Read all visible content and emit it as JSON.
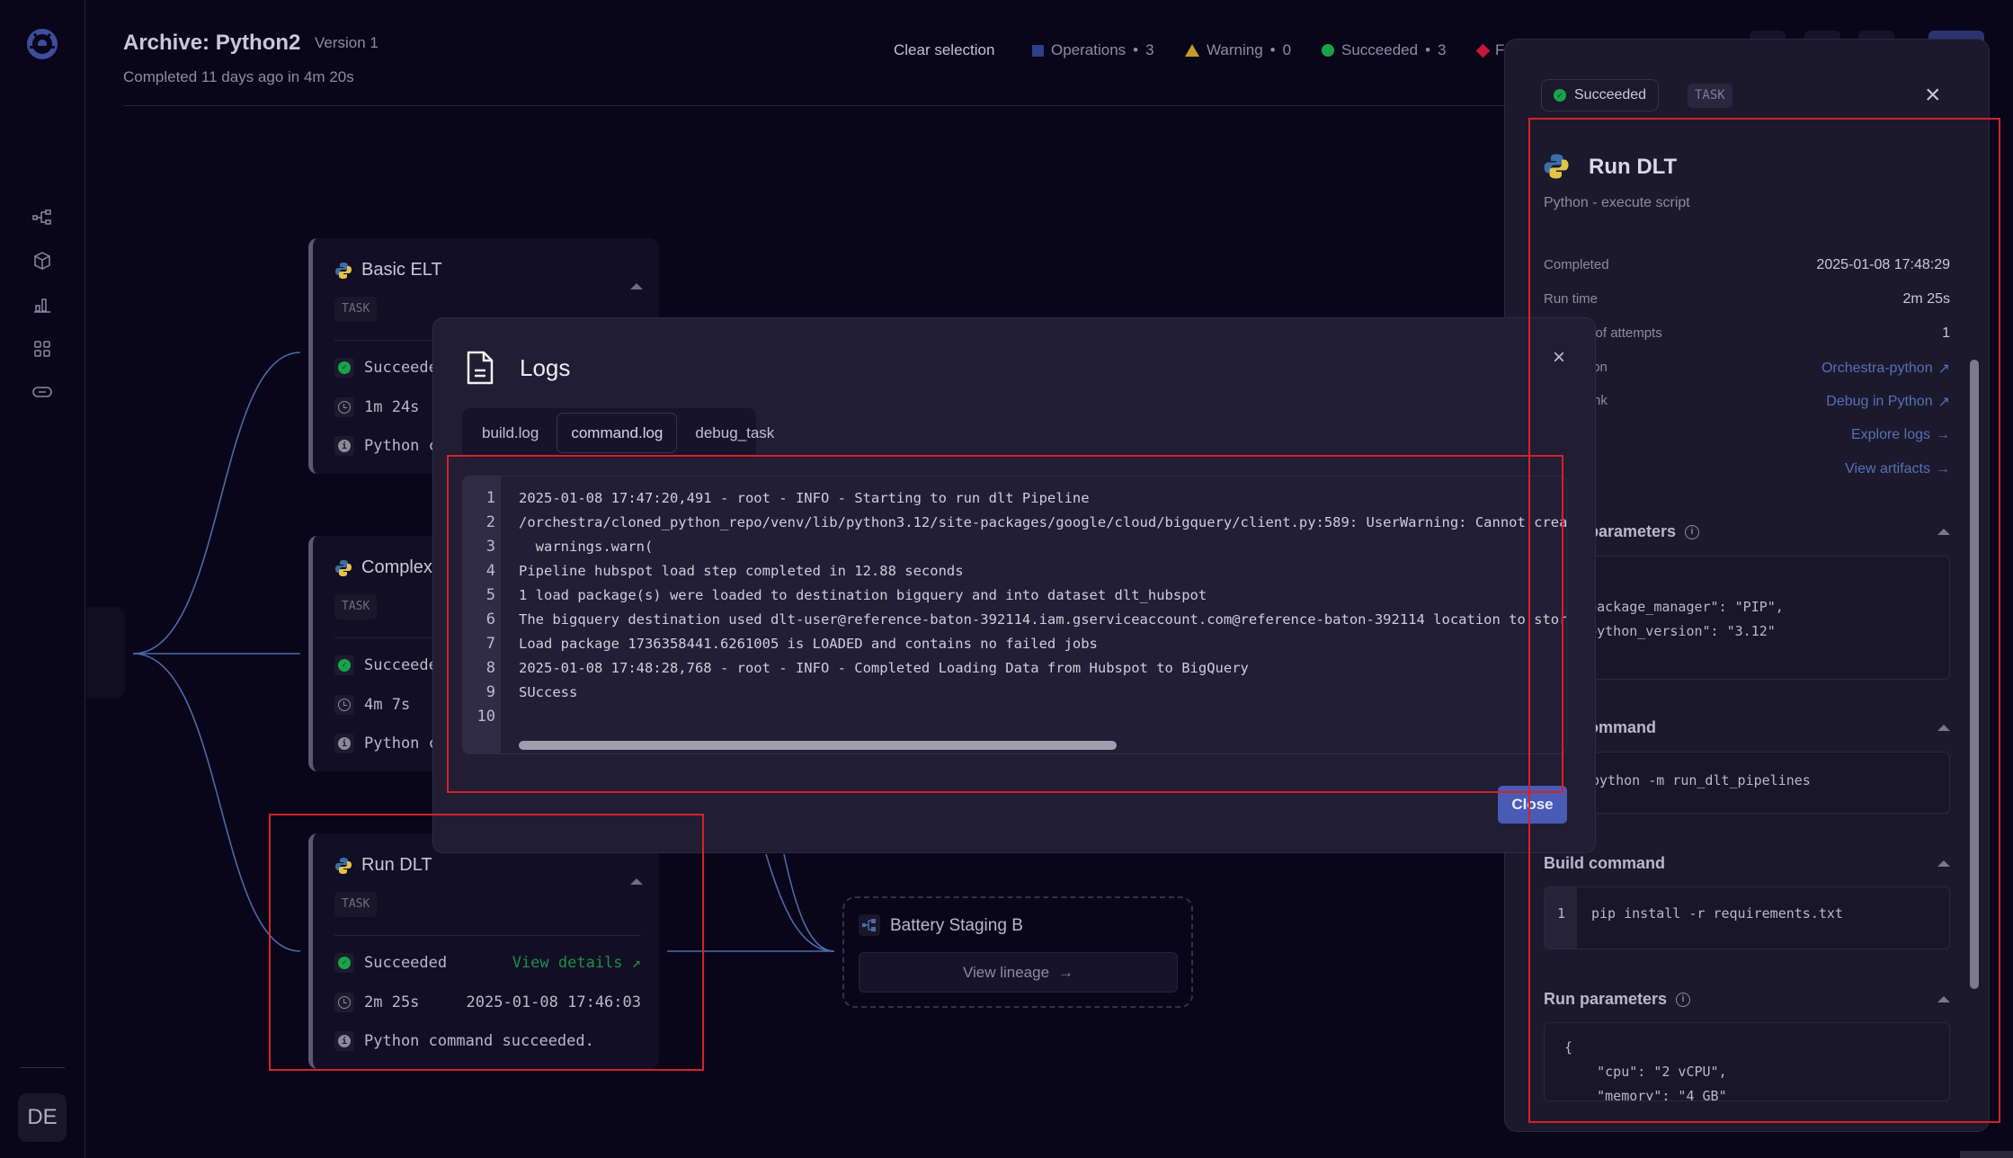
{
  "sidebar": {
    "nav_icons": [
      "pipelines-icon",
      "packages-icon",
      "analytics-icon",
      "integrations-icon",
      "links-icon"
    ],
    "avatar_initials": "DE"
  },
  "header": {
    "title": "Archive: Python2",
    "version": "Version 1",
    "subtitle": "Completed 11 days ago in 4m 20s",
    "clear_selection": "Clear selection",
    "stats": [
      {
        "label": "Operations",
        "count": "3",
        "icon": "operations-icon",
        "color": "#3b4fa0"
      },
      {
        "label": "Warning",
        "count": "0",
        "icon": "warning-icon",
        "color": "#c89a2a"
      },
      {
        "label": "Succeeded",
        "count": "3",
        "icon": "success-icon",
        "color": "#17a34a"
      },
      {
        "label": "F",
        "count": "",
        "icon": "failed-icon",
        "color": "#c8173a"
      }
    ],
    "separator": "•"
  },
  "dag": {
    "tasks": [
      {
        "name": "Basic ELT",
        "tag": "TASK",
        "status": "Succeede",
        "duration": "1m 24s",
        "message": "Python c",
        "timestamp": "",
        "link": ""
      },
      {
        "name": "Complex",
        "tag": "TASK",
        "status": "Succeede",
        "duration": "4m 7s",
        "message": "Python c",
        "timestamp": "",
        "link": ""
      },
      {
        "name": "Run DLT",
        "tag": "TASK",
        "status": "Succeeded",
        "duration": "2m 25s",
        "message": "Python command succeeded.",
        "timestamp": "2025-01-08 17:46:03",
        "link": "View details ↗"
      }
    ],
    "lineage": {
      "name": "Battery Staging B",
      "button": "View lineage",
      "arrow": "→"
    }
  },
  "logs_modal": {
    "title": "Logs",
    "close_x": "×",
    "tabs": [
      "build.log",
      "command.log",
      "debug_task"
    ],
    "active_tab": "command.log",
    "lines": [
      "2025-01-08 17:47:20,491 - root - INFO - Starting to run dlt Pipeline",
      "/orchestra/cloned_python_repo/venv/lib/python3.12/site-packages/google/cloud/bigquery/client.py:589: UserWarning: Cannot creat",
      "  warnings.warn(",
      "Pipeline hubspot load step completed in 12.88 seconds",
      "1 load package(s) were loaded to destination bigquery and into dataset dlt_hubspot",
      "The bigquery destination used dlt-user@reference-baton-392114.iam.gserviceaccount.com@reference-baton-392114 location to store",
      "Load package 1736358441.6261005 is LOADED and contains no failed jobs",
      "2025-01-08 17:48:28,768 - root - INFO - Completed Loading Data from Hubspot to BigQuery",
      "SUccess",
      ""
    ],
    "line_numbers": [
      "1",
      "2",
      "3",
      "4",
      "5",
      "6",
      "7",
      "8",
      "9",
      "10"
    ],
    "close_button": "Close"
  },
  "detail_panel": {
    "status": "Succeeded",
    "tag": "TASK",
    "close_x": "×",
    "title": "Run DLT",
    "subtitle": "Python - execute script",
    "fields": [
      {
        "label": "Completed",
        "value": "2025-01-08 17:48:29"
      },
      {
        "label": "Run time",
        "value": "2m 25s"
      },
      {
        "label": "Number of attempts",
        "value": "1"
      }
    ],
    "links": [
      {
        "label": "Integration",
        "value": "Orchestra-python",
        "icon": "external-link-icon"
      },
      {
        "label": "Debug link",
        "value": "Debug in Python",
        "icon": "external-link-icon"
      },
      {
        "label": "",
        "value": "Explore logs",
        "icon": "arrow-right-icon"
      },
      {
        "label": "Artifacts",
        "value": "View artifacts",
        "icon": "arrow-right-icon"
      }
    ],
    "sections": {
      "parameters": {
        "title": "Build parameters",
        "lines": [
          "{",
          "  \"package_manager\": \"PIP\",",
          "  \"python_version\": \"3.12\"",
          "}"
        ]
      },
      "run_command": {
        "title": "Run command",
        "lines": [
          "python -m run_dlt_pipelines"
        ]
      },
      "build_command": {
        "title": "Build command",
        "line_number": "1",
        "lines": [
          "pip install -r requirements.txt"
        ]
      },
      "run_parameters": {
        "title": "Run parameters",
        "lines": [
          "{",
          "    \"cpu\": \"2 vCPU\",",
          "    \"memory\": \"4 GB\""
        ]
      }
    }
  }
}
